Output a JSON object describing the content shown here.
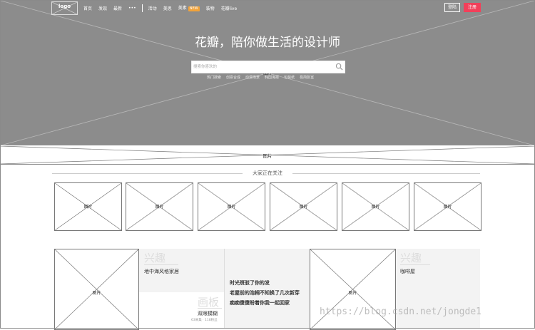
{
  "header": {
    "logo": "logo",
    "nav": [
      "首页",
      "发现",
      "最新",
      "•••"
    ],
    "nav2": [
      "活动",
      "美思",
      "美素",
      "装物",
      "花瓣live"
    ],
    "new_badge": "NEW",
    "login": "登陆",
    "signup": "注册"
  },
  "hero": {
    "title": "花瓣，陪你做生活的设计师",
    "search_placeholder": "搜索你喜欢的",
    "hot_label": "热门搜索",
    "hot": [
      "创意合成",
      "动漫场景",
      "韩国海报",
      "包装纸",
      "极简卧室"
    ],
    "image_label": "图片"
  },
  "banner": {
    "image_label": "图片"
  },
  "follow": {
    "title": "大家正在关注",
    "cards": [
      "图片",
      "图片",
      "图片",
      "图片",
      "图片",
      "图片"
    ]
  },
  "feed": {
    "img1": "图片",
    "img2": "图片",
    "cat1": "兴趣",
    "cat1_sub": "地中海风格家居",
    "cat2": "画板",
    "cat2_sub": "双眼模糊",
    "cat2_meta": "63采集 · 118粉丝",
    "poem": [
      "时光斑驳了你的发",
      "老屋前的泡桐不知换了几次新芽",
      "痴痴傻傻盼着你我一起回家"
    ],
    "cat3": "兴趣",
    "cat3_sub": "咖啡屋"
  },
  "watermark": "https://blog.csdn.net/jongde1",
  "colors": {
    "hero_bg": "#8c8c8c",
    "signup": "#f2405a",
    "new_badge": "#f2a33a"
  }
}
